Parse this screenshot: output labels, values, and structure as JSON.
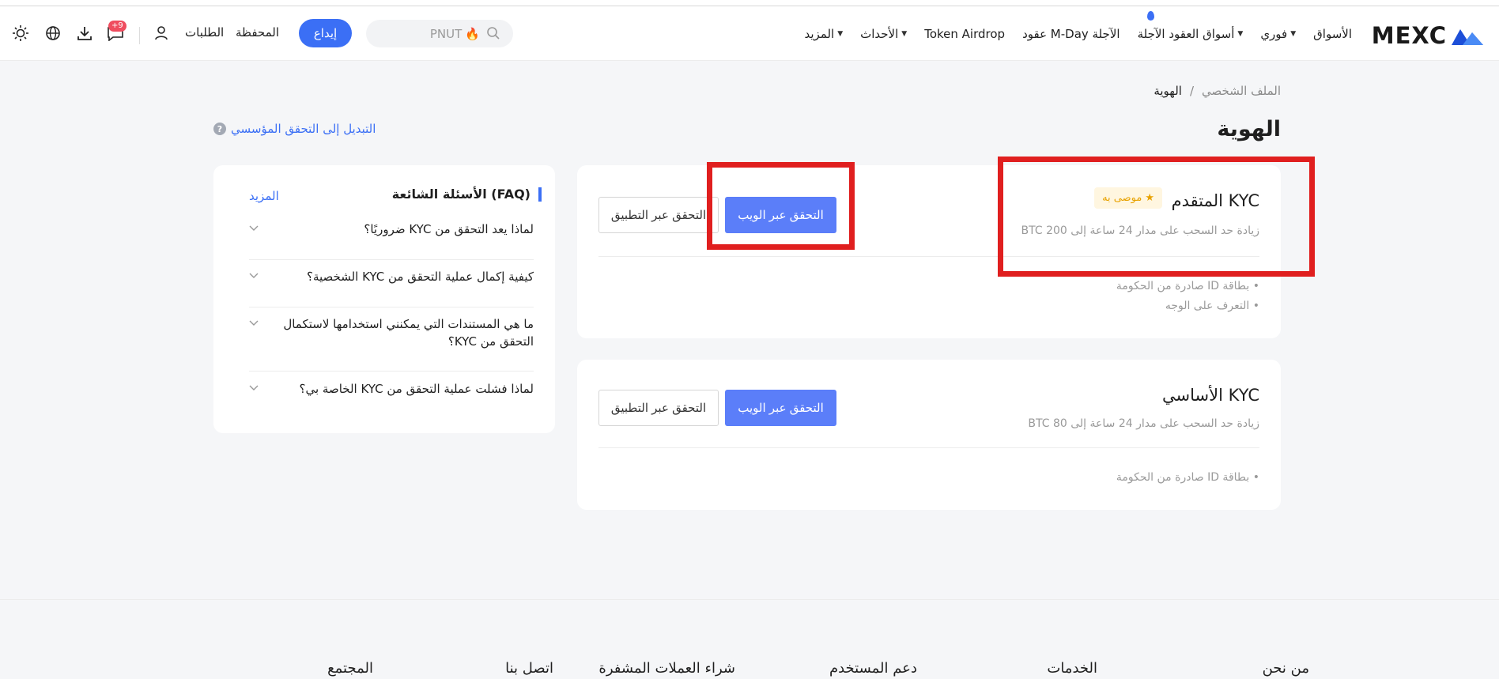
{
  "brand": {
    "logo_text": "MEXC",
    "accent": "#3b6ff5"
  },
  "nav": {
    "items": [
      {
        "label": "الأسواق",
        "dropdown": false
      },
      {
        "label": "فوري",
        "dropdown": true
      },
      {
        "label": "أسواق العقود الآجلة",
        "dropdown": true
      },
      {
        "label": "عقود M-Day الآجلة",
        "dropdown": false
      },
      {
        "label": "Token Airdrop",
        "dropdown": false
      },
      {
        "label": "الأحداث",
        "dropdown": true
      },
      {
        "label": "المزيد",
        "dropdown": true
      }
    ]
  },
  "header": {
    "search_value": "PNUT",
    "deposit_label": "إيداع",
    "wallet_label": "المحفظة",
    "orders_label": "الطلبات",
    "notification_count": "+9"
  },
  "breadcrumb": {
    "parent": "الملف الشخصي",
    "separator": "/",
    "current": "الهوية"
  },
  "page": {
    "title": "الهوية",
    "switch_link": "التبديل إلى التحقق المؤسسي"
  },
  "kyc_cards": [
    {
      "title": "KYC المتقدم",
      "badge": "موصى به",
      "description": "زيادة حد السحب على مدار 24 ساعة إلى 200 BTC",
      "web_button": "التحقق عبر الويب",
      "app_button": "التحقق عبر التطبيق",
      "requirements": [
        "• بطاقة ID صادرة من الحكومة",
        "• التعرف على الوجه"
      ]
    },
    {
      "title": "KYC الأساسي",
      "description": "زيادة حد السحب على مدار 24 ساعة إلى 80 BTC",
      "web_button": "التحقق عبر الويب",
      "app_button": "التحقق عبر التطبيق",
      "requirements": [
        "• بطاقة ID صادرة من الحكومة"
      ]
    }
  ],
  "faq": {
    "title": "الأسئلة الشائعة (FAQ)",
    "more_label": "المزيد",
    "items": [
      "لماذا يعد التحقق من KYC ضروريًا؟",
      "كيفية إكمال عملية التحقق من KYC الشخصية؟",
      "ما هي المستندات التي يمكنني استخدامها لاستكمال التحقق من KYC؟",
      "لماذا فشلت عملية التحقق من KYC الخاصة بي؟"
    ]
  },
  "footer": {
    "columns": [
      "من نحن",
      "الخدمات",
      "دعم المستخدم",
      "شراء العملات المشفرة",
      "اتصل بنا",
      "المجتمع"
    ]
  }
}
